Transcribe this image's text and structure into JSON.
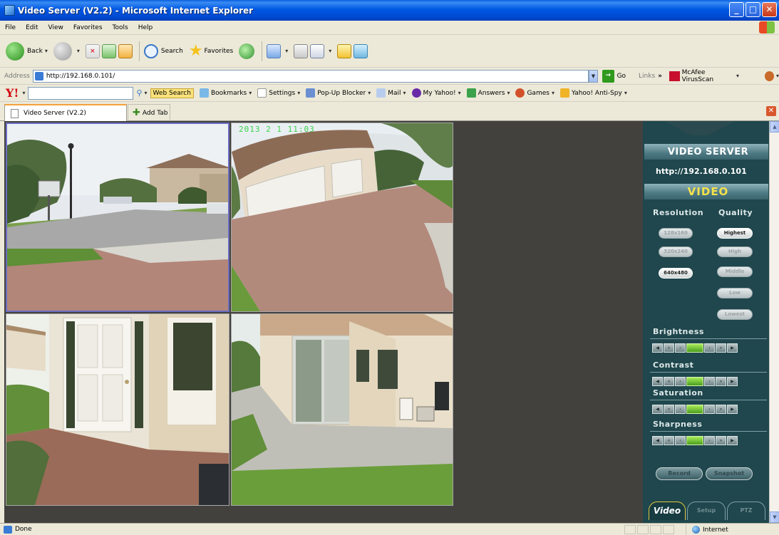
{
  "window": {
    "title": "Video Server (V2.2) - Microsoft Internet Explorer"
  },
  "menu": [
    "File",
    "Edit",
    "View",
    "Favorites",
    "Tools",
    "Help"
  ],
  "toolbar": {
    "back": "Back",
    "search": "Search",
    "favorites": "Favorites"
  },
  "address": {
    "label": "Address",
    "url": "http://192.168.0.101/",
    "go": "Go",
    "links": "Links",
    "links_more": "»",
    "mcafee": "McAfee VirusScan"
  },
  "yahoo": {
    "logo": "Y!",
    "web_search": "Web Search",
    "bookmarks": "Bookmarks",
    "settings": "Settings",
    "popup": "Pop-Up Blocker",
    "mail": "Mail",
    "my_yahoo": "My Yahoo!",
    "answers": "Answers",
    "games": "Games",
    "antispy": "Yahoo! Anti-Spy"
  },
  "tabs": {
    "active": "Video Server (V2.2)",
    "add": "Add Tab"
  },
  "camera": {
    "timestamp": "2013 2 1 11:03"
  },
  "panel": {
    "title": "VIDEO SERVER",
    "url": "http://192.168.0.101",
    "video": "VIDEO",
    "resolution_label": "Resolution",
    "quality_label": "Quality",
    "resolutions": [
      {
        "label": "128x160",
        "active": false
      },
      {
        "label": "320x240",
        "active": false
      },
      {
        "label": "640x480",
        "active": true
      }
    ],
    "qualities": [
      {
        "label": "Highest",
        "active": true
      },
      {
        "label": "High",
        "active": false
      },
      {
        "label": "Middle",
        "active": false
      },
      {
        "label": "Low",
        "active": false
      },
      {
        "label": "Lowest",
        "active": false
      }
    ],
    "brightness": "Brightness",
    "contrast": "Contrast",
    "saturation": "Saturation",
    "sharpness": "Sharpness",
    "stepper_level": 0,
    "record": "Record",
    "snapshot": "Snapshot",
    "tab_video": "Video",
    "tab_setup": "Setup",
    "tab_ptz": "PTZ"
  },
  "status": {
    "text": "Done",
    "zone": "Internet"
  },
  "colors": {
    "panel_bg": "#1f474d",
    "timestamp": "#3ad24a",
    "active_border": "#6b6dc2",
    "stepper_active": "#4a9d1e"
  }
}
